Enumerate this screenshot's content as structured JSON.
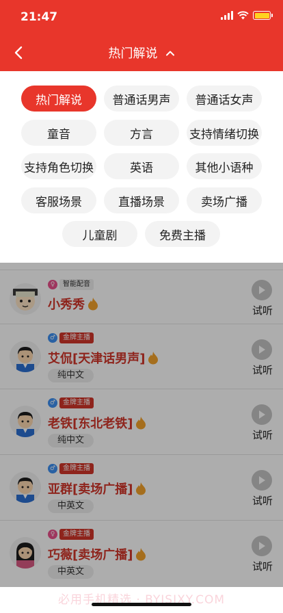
{
  "status": {
    "time": "21:47"
  },
  "colors": {
    "brand": "#e8362b",
    "accent": "#d2352a"
  },
  "nav": {
    "title": "热门解说",
    "back_icon": "chevron-left-icon",
    "toggle_icon": "chevron-up-icon"
  },
  "categories": [
    {
      "label": "热门解说",
      "active": true
    },
    {
      "label": "普通话男声"
    },
    {
      "label": "普通话女声"
    },
    {
      "label": "童音"
    },
    {
      "label": "方言"
    },
    {
      "label": "支持情绪切换"
    },
    {
      "label": "支持角色切换"
    },
    {
      "label": "英语"
    },
    {
      "label": "其他小语种"
    },
    {
      "label": "客服场景"
    },
    {
      "label": "直播场景"
    },
    {
      "label": "卖场广播"
    },
    {
      "label": "儿童剧"
    },
    {
      "label": "免费主播"
    }
  ],
  "anchors": [
    {
      "name": "小秀秀",
      "badge": "智能配音",
      "gender": "female",
      "avatar": "child-avatar-icon"
    },
    {
      "name": "艾侃[天津话男声]",
      "badge": "金牌主播",
      "gender": "male",
      "tag": "纯中文",
      "avatar": "man-avatar-icon"
    },
    {
      "name": "老铁[东北老铁]",
      "badge": "金牌主播",
      "gender": "male",
      "tag": "纯中文",
      "avatar": "man-avatar-icon"
    },
    {
      "name": "亚群[卖场广播]",
      "badge": "金牌主播",
      "gender": "male",
      "tag": "中英文",
      "avatar": "man-avatar-icon"
    },
    {
      "name": "巧薇[卖场广播]",
      "badge": "金牌主播",
      "gender": "female",
      "tag": "中英文",
      "avatar": "woman-avatar-icon"
    }
  ],
  "listen_label": "试听",
  "watermark": "必用手机精选 · BYJSJXY.COM"
}
